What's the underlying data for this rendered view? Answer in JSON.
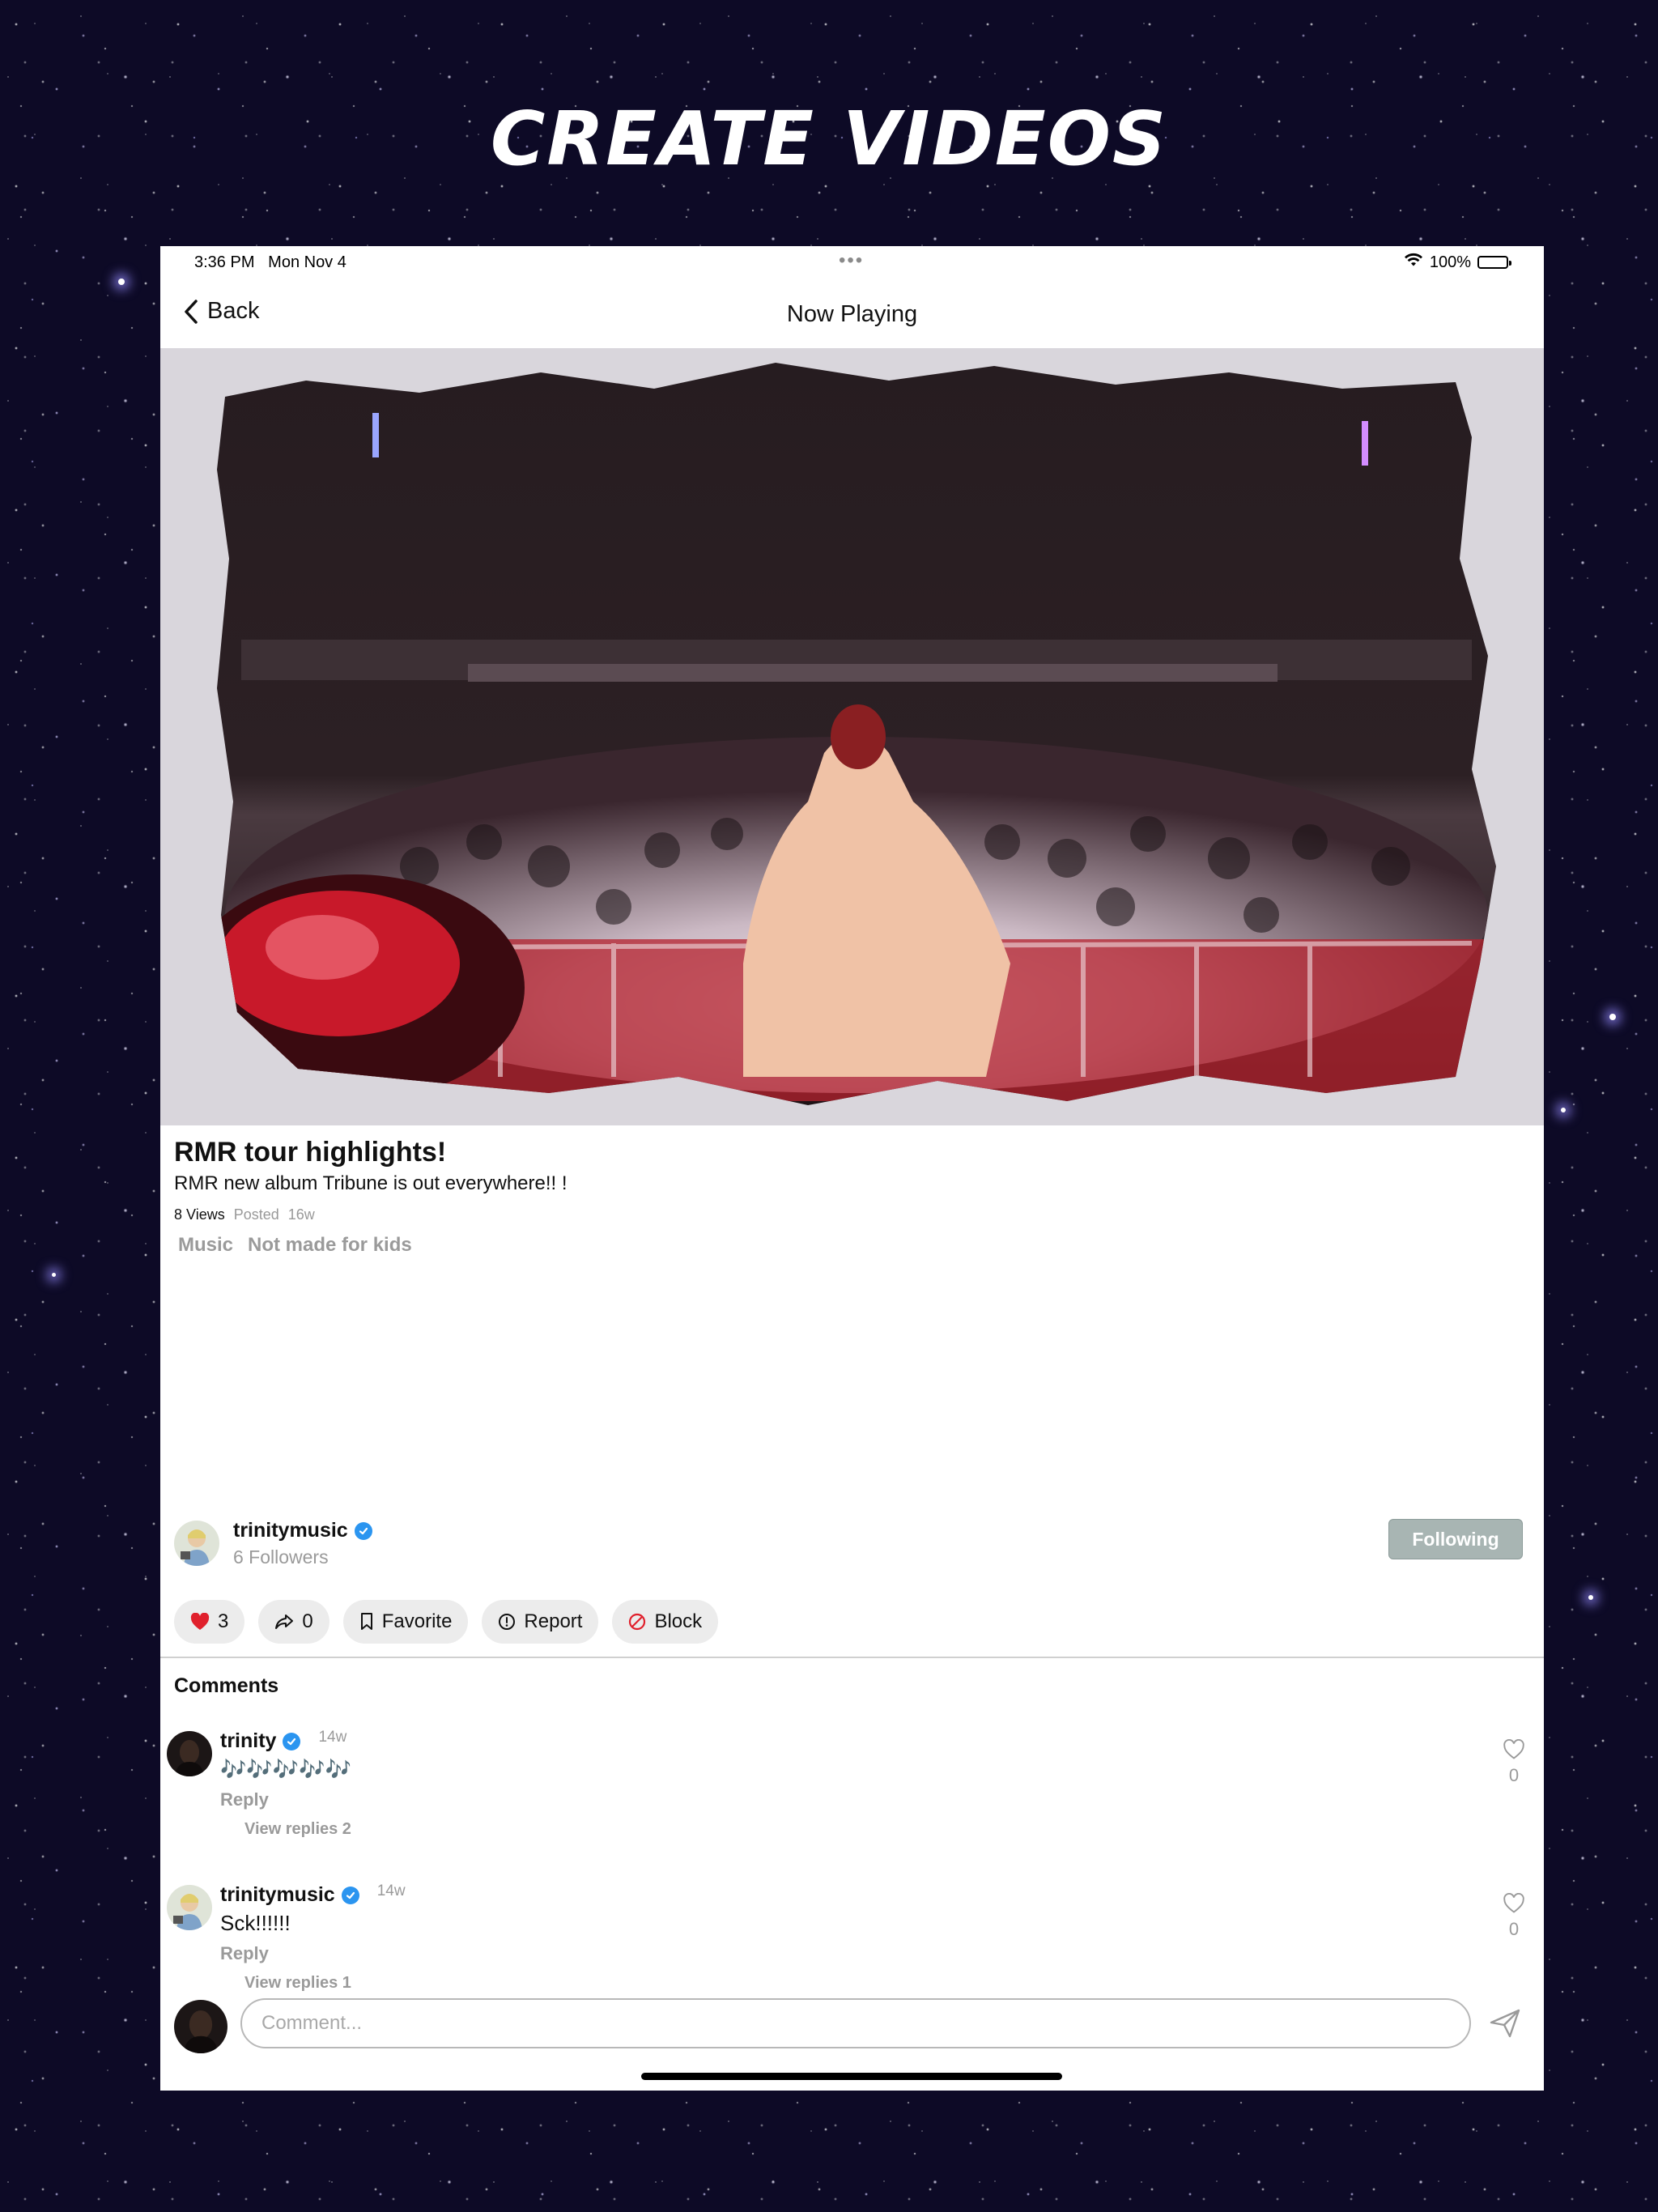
{
  "promo": {
    "title": "CREATE VIDEOS"
  },
  "status_bar": {
    "time": "3:36 PM",
    "date": "Mon Nov 4",
    "battery": "100%"
  },
  "nav": {
    "back_label": "Back",
    "title": "Now Playing"
  },
  "video": {
    "title": "RMR tour highlights!",
    "description": "RMR new album Tribune is out everywhere!! !",
    "views": "8 Views",
    "posted_label": "Posted",
    "posted_age": "16w",
    "tags": [
      "Music",
      "Not made for kids"
    ]
  },
  "channel": {
    "name": "trinitymusic",
    "followers": "6 Followers",
    "follow_label": "Following"
  },
  "actions": {
    "likes": "3",
    "shares": "0",
    "favorite": "Favorite",
    "report": "Report",
    "block": "Block"
  },
  "comments": {
    "heading": "Comments",
    "reply_label": "Reply",
    "items": [
      {
        "user": "trinity",
        "age": "14w",
        "text": "🎶🎶🎶🎶🎶",
        "likes": "0",
        "view_replies": "View replies  2"
      },
      {
        "user": "trinitymusic",
        "age": "14w",
        "text": "Sck!!!!!!",
        "likes": "0",
        "view_replies": "View replies  1"
      }
    ]
  },
  "composer": {
    "placeholder": "Comment..."
  },
  "colors": {
    "accent_blue": "#2b95f0",
    "heart_red": "#e0202c",
    "block_red": "#e0202c",
    "follow_bg": "#a8b5b3"
  }
}
